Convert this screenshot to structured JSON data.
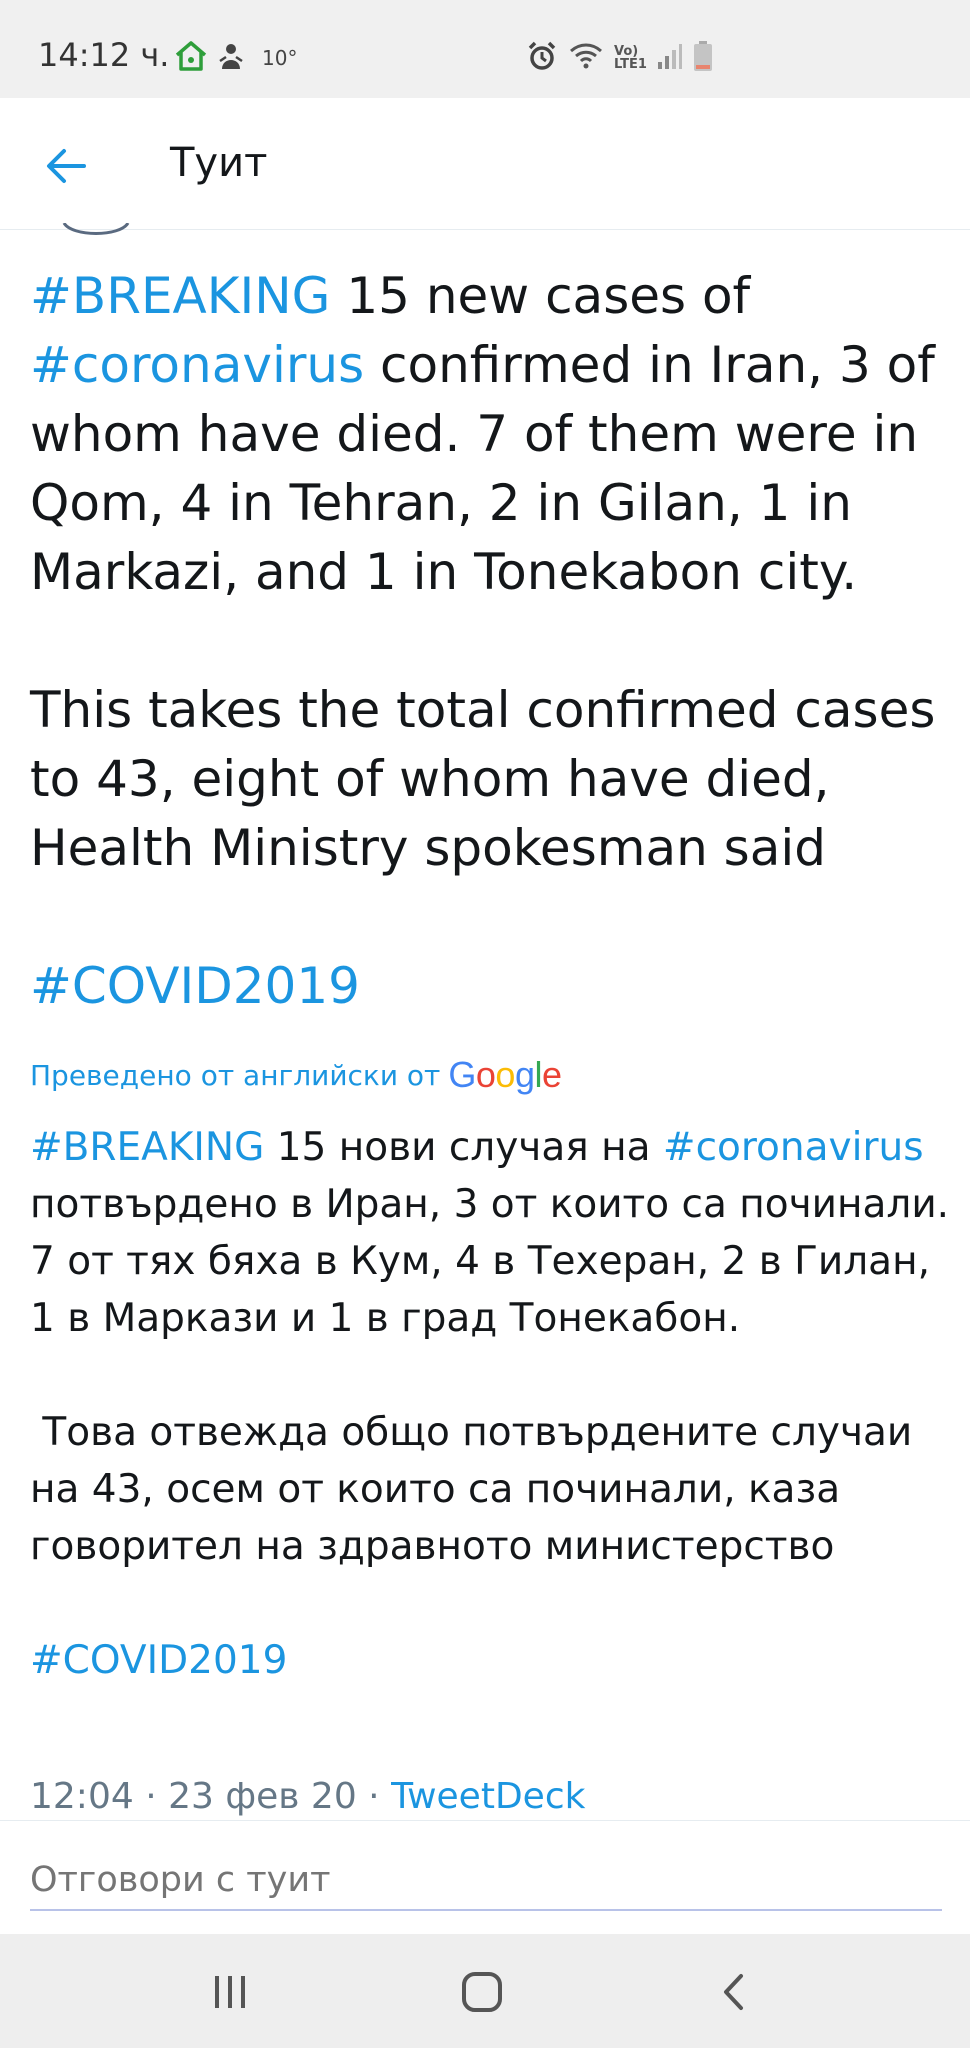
{
  "status_bar": {
    "time": "14:12 ч.",
    "temperature": "10°",
    "icons": [
      "home-icon",
      "weather-icon",
      "alarm-icon",
      "wifi-icon",
      "volte-lte-icon",
      "signal-icon",
      "battery-icon"
    ],
    "volte_label_top": "Vo)",
    "volte_label_bottom": "LTE1"
  },
  "app_bar": {
    "title": "Туит",
    "back_icon": "back-arrow-icon"
  },
  "tweet": {
    "main": {
      "p1_tag1": "#BREAKING",
      "p1_text1": " 15 new cases of ",
      "p1_tag2": "#coronavirus",
      "p1_text2": " confirmed in Iran, 3 of whom have died. 7 of them were in Qom, 4 in Tehran, 2 in Gilan, 1 in Markazi, and 1 in Tonekabon city.",
      "p2_text": "This takes the total confirmed cases to 43, eight of whom have died, Health Ministry spokesman said",
      "p3_tag": "#COVID2019"
    },
    "translation_label": "Преведено от английски от",
    "translation_provider": "Google",
    "translated": {
      "p1_tag1": "#BREAKING",
      "p1_text1": " 15 нови случая на ",
      "p1_tag2": "#coronavirus",
      "p1_text2": " потвърдено в Иран, 3 от които са починали. 7 от тях бяха в Кум, 4 в Техеран, 2 в Гилан, 1 в Маркази и 1 в град Тонекабон.",
      "p2_text": " Това отвежда общо потвърдените случаи на 43, осем от които са починали, каза говорител на здравното министерство",
      "p3_tag": "#COVID2019"
    },
    "time_date": "12:04 · 23 фев 20 · ",
    "source": "TweetDeck"
  },
  "reply": {
    "placeholder": "Отговори с туит"
  },
  "nav_bar": {
    "icons": [
      "recents-icon",
      "home-nav-icon",
      "back-nav-icon"
    ]
  },
  "colors": {
    "link": "#1b95e0",
    "text": "#14171a",
    "muted": "#657786",
    "google_blue": "#4285F4",
    "google_red": "#EA4335",
    "google_yellow": "#FBBC05",
    "google_green": "#34A853"
  }
}
